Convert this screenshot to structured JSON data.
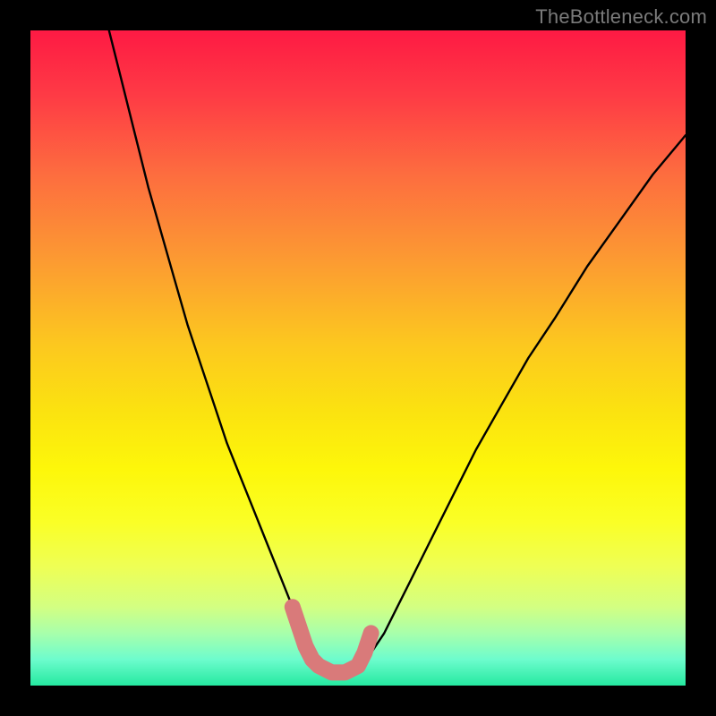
{
  "watermark": "TheBottleneck.com",
  "chart_data": {
    "type": "line",
    "title": "",
    "xlabel": "",
    "ylabel": "",
    "xlim": [
      0,
      100
    ],
    "ylim": [
      0,
      100
    ],
    "series": [
      {
        "name": "bottleneck-curve",
        "x": [
          12,
          14,
          16,
          18,
          20,
          22,
          24,
          26,
          28,
          30,
          32,
          34,
          36,
          38,
          40,
          41,
          42,
          43,
          44,
          46,
          48,
          50,
          52,
          54,
          56,
          58,
          60,
          62,
          65,
          68,
          72,
          76,
          80,
          85,
          90,
          95,
          100
        ],
        "values": [
          100,
          92,
          84,
          76,
          69,
          62,
          55,
          49,
          43,
          37,
          32,
          27,
          22,
          17,
          12,
          9,
          6,
          4,
          3,
          2,
          2,
          3,
          5,
          8,
          12,
          16,
          20,
          24,
          30,
          36,
          43,
          50,
          56,
          64,
          71,
          78,
          84
        ]
      }
    ],
    "highlight": {
      "name": "bottleneck-floor-marker",
      "color": "#d97a7a",
      "x": [
        40,
        41,
        42,
        43,
        44,
        46,
        48,
        50,
        51,
        52
      ],
      "values": [
        12,
        9,
        6,
        4,
        3,
        2,
        2,
        3,
        5,
        8
      ]
    }
  }
}
